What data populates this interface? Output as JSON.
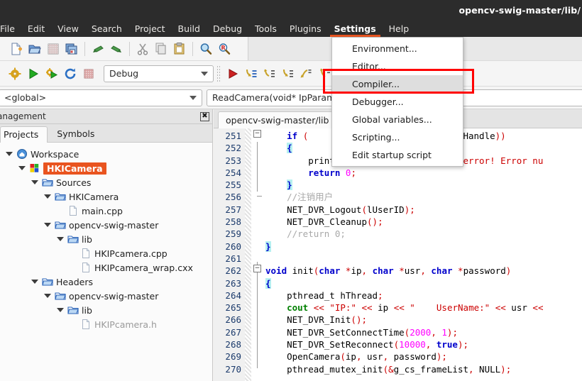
{
  "window": {
    "title": "opencv-swig-master/lib/"
  },
  "menubar": {
    "items": [
      {
        "label": "File",
        "active": false
      },
      {
        "label": "Edit",
        "active": false
      },
      {
        "label": "View",
        "active": false
      },
      {
        "label": "Search",
        "active": false
      },
      {
        "label": "Project",
        "active": false
      },
      {
        "label": "Build",
        "active": false
      },
      {
        "label": "Debug",
        "active": false
      },
      {
        "label": "Tools",
        "active": false
      },
      {
        "label": "Plugins",
        "active": false
      },
      {
        "label": "Settings",
        "active": true
      },
      {
        "label": "Help",
        "active": false
      }
    ]
  },
  "settings_menu": {
    "items": [
      {
        "label": "Environment...",
        "highlighted": false
      },
      {
        "label": "Editor...",
        "highlighted": false
      },
      {
        "label": "Compiler...",
        "highlighted": true
      },
      {
        "label": "Debugger...",
        "highlighted": false
      },
      {
        "label": "Global variables...",
        "highlighted": false
      },
      {
        "label": "Scripting...",
        "highlighted": false
      },
      {
        "label": "Edit startup script",
        "highlighted": false
      }
    ]
  },
  "annotation": {
    "color": "#ff0000",
    "target": "Compiler..."
  },
  "toolbar_main": {
    "buttons": [
      {
        "name": "new-file-icon",
        "tooltip": "New file"
      },
      {
        "name": "open-file-icon",
        "tooltip": "Open"
      },
      {
        "name": "save-icon",
        "tooltip": "Save"
      },
      {
        "name": "save-all-icon",
        "tooltip": "Save all"
      },
      {
        "name": "undo-icon",
        "tooltip": "Undo"
      },
      {
        "name": "redo-icon",
        "tooltip": "Redo"
      },
      {
        "name": "cut-icon",
        "tooltip": "Cut"
      },
      {
        "name": "copy-icon",
        "tooltip": "Copy"
      },
      {
        "name": "paste-icon",
        "tooltip": "Paste"
      },
      {
        "name": "search-icon",
        "tooltip": "Find"
      },
      {
        "name": "replace-icon",
        "tooltip": "Replace"
      }
    ]
  },
  "toolbar_build": {
    "buttons": [
      {
        "name": "build-icon",
        "tooltip": "Build"
      },
      {
        "name": "run-icon",
        "tooltip": "Run"
      },
      {
        "name": "build-and-run-icon",
        "tooltip": "Build and run"
      },
      {
        "name": "rebuild-icon",
        "tooltip": "Rebuild"
      },
      {
        "name": "abort-icon",
        "tooltip": "Abort"
      }
    ],
    "target_combo": {
      "value": "Debug",
      "placeholder": "Debug"
    }
  },
  "toolbar_debug": {
    "buttons": [
      {
        "name": "debug-continue-icon",
        "tooltip": "Debug / Continue"
      },
      {
        "name": "step-into-icon",
        "tooltip": "Step into"
      },
      {
        "name": "step-out-icon",
        "tooltip": "Step out"
      },
      {
        "name": "next-line-icon",
        "tooltip": "Next line"
      },
      {
        "name": "next-instruction-icon",
        "tooltip": "Next instruction"
      },
      {
        "name": "step-into-instruction-icon",
        "tooltip": "Step into instruction"
      }
    ]
  },
  "scopebar": {
    "scope": {
      "value": "<global>"
    },
    "function": {
      "value": "ReadCamera(void* IpParam"
    }
  },
  "left_panel": {
    "header_title": "anagement",
    "close_label": "✖",
    "tabs": [
      {
        "label": "Projects",
        "selected": true
      },
      {
        "label": "Symbols",
        "selected": false
      }
    ],
    "tree": [
      {
        "label": "Workspace",
        "depth": 0,
        "icon": "workspace-icon",
        "twist": true,
        "state": "normal"
      },
      {
        "label": "HKICamera",
        "depth": 1,
        "icon": "project-icon",
        "twist": true,
        "state": "selected"
      },
      {
        "label": "Sources",
        "depth": 2,
        "icon": "folder-icon",
        "twist": true,
        "state": "normal"
      },
      {
        "label": "HKICamera",
        "depth": 3,
        "icon": "folder-icon",
        "twist": true,
        "state": "normal"
      },
      {
        "label": "main.cpp",
        "depth": 4,
        "icon": "file-icon",
        "twist": false,
        "state": "normal"
      },
      {
        "label": "opencv-swig-master",
        "depth": 3,
        "icon": "folder-icon",
        "twist": true,
        "state": "normal"
      },
      {
        "label": "lib",
        "depth": 4,
        "icon": "folder-icon",
        "twist": true,
        "state": "normal"
      },
      {
        "label": "HKIPcamera.cpp",
        "depth": 5,
        "icon": "file-icon",
        "twist": false,
        "state": "normal"
      },
      {
        "label": "HKIPcamera_wrap.cxx",
        "depth": 5,
        "icon": "file-icon",
        "twist": false,
        "state": "normal"
      },
      {
        "label": "Headers",
        "depth": 2,
        "icon": "folder-icon",
        "twist": true,
        "state": "normal"
      },
      {
        "label": "opencv-swig-master",
        "depth": 3,
        "icon": "folder-icon",
        "twist": true,
        "state": "normal"
      },
      {
        "label": "lib",
        "depth": 4,
        "icon": "folder-icon",
        "twist": true,
        "state": "normal"
      },
      {
        "label": "HKIPcamera.h",
        "depth": 5,
        "icon": "file-icon",
        "twist": false,
        "state": "dim"
      }
    ]
  },
  "editor": {
    "tab_label": "opencv-swig-master/lib",
    "first_line": 251,
    "lines": [
      {
        "n": 251,
        "text": "    if (                    .RealPlayHandle))"
      },
      {
        "n": 252,
        "text": "    {"
      },
      {
        "n": 253,
        "text": "        printf(\"NET_DVR_StopRealPlay error! Error nu"
      },
      {
        "n": 254,
        "text": "        return 0;"
      },
      {
        "n": 255,
        "text": "    }"
      },
      {
        "n": 256,
        "text": "    //注销用户"
      },
      {
        "n": 257,
        "text": "    NET_DVR_Logout(lUserID);"
      },
      {
        "n": 258,
        "text": "    NET_DVR_Cleanup();"
      },
      {
        "n": 259,
        "text": "    //return 0;"
      },
      {
        "n": 260,
        "text": "}"
      },
      {
        "n": 261,
        "text": ""
      },
      {
        "n": 262,
        "text": "void init(char *ip, char *usr, char *password)"
      },
      {
        "n": 263,
        "text": "{"
      },
      {
        "n": 264,
        "text": "    pthread_t hThread;"
      },
      {
        "n": 265,
        "text": "    cout << \"IP:\" << ip << \"    UserName:\" << usr <<"
      },
      {
        "n": 266,
        "text": "    NET_DVR_Init();"
      },
      {
        "n": 267,
        "text": "    NET_DVR_SetConnectTime(2000, 1);"
      },
      {
        "n": 268,
        "text": "    NET_DVR_SetReconnect(10000, true);"
      },
      {
        "n": 269,
        "text": "    OpenCamera(ip, usr, password);"
      },
      {
        "n": 270,
        "text": "    pthread_mutex_init(&g_cs_frameList, NULL);"
      }
    ]
  },
  "colors": {
    "accent": "#e95420",
    "titlebar_bg": "#2c2c2c",
    "selection_bg": "#e9541f",
    "annotation": "#ff0000",
    "keyword": "#0000cc",
    "string": "#cc0000",
    "number": "#ff00ff",
    "comment": "#a8a8a8",
    "linenumber": "#1b3a6b"
  }
}
